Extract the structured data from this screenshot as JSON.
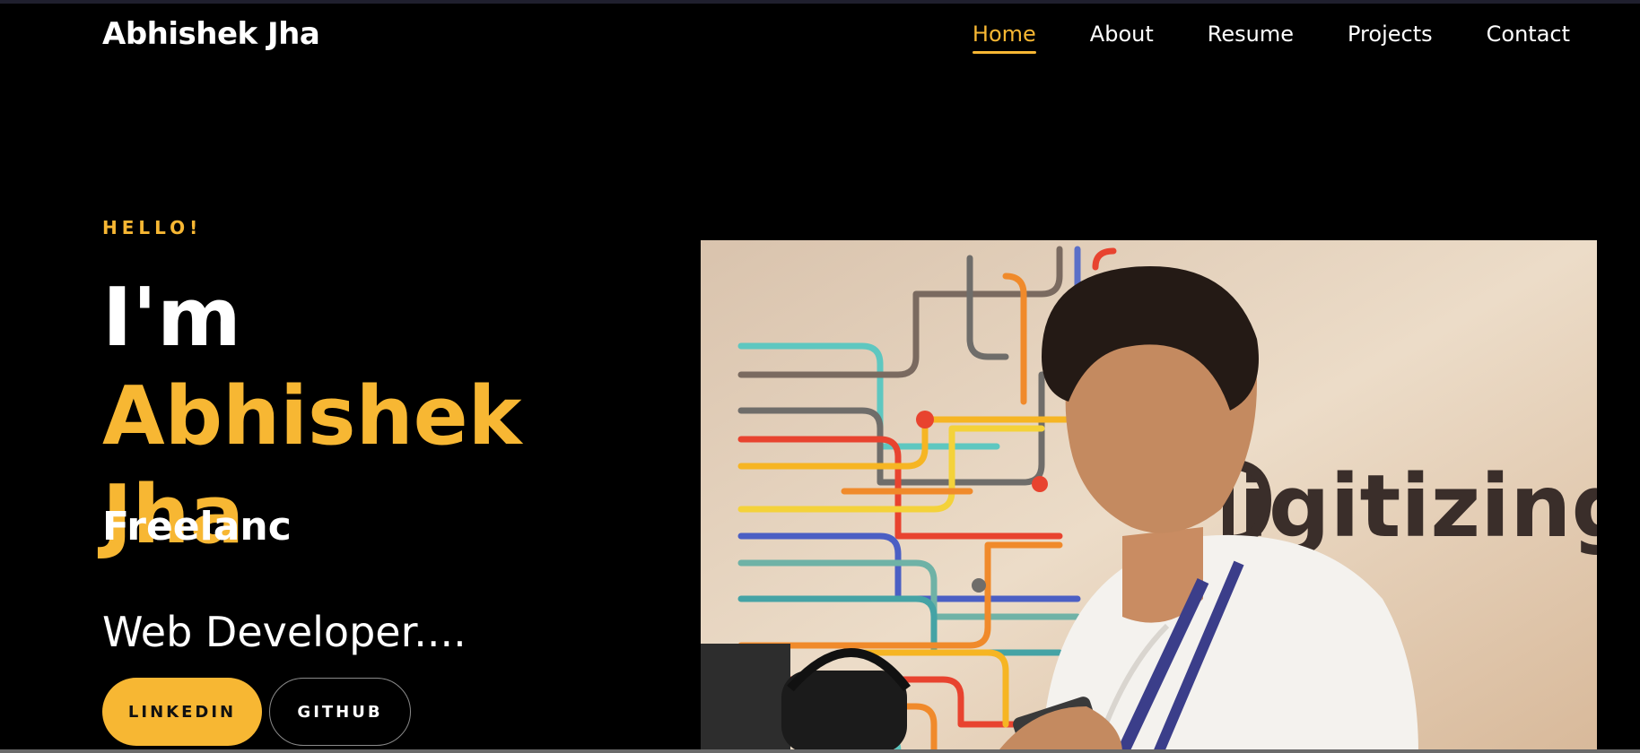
{
  "brand": {
    "name": "Abhishek Jha"
  },
  "nav": {
    "items": [
      {
        "label": "Home",
        "active": true
      },
      {
        "label": "About",
        "active": false
      },
      {
        "label": "Resume",
        "active": false
      },
      {
        "label": "Projects",
        "active": false
      },
      {
        "label": "Contact",
        "active": false
      }
    ]
  },
  "hero": {
    "greeting": "HELLO!",
    "headline_prefix": "I'm ",
    "headline_name": "Abhishek Jha",
    "typed_role": "Freelanc",
    "role_line": "Web Developer....",
    "buttons": {
      "linkedin": "LINKEDIN",
      "github": "GITHUB"
    },
    "photo": {
      "wall_text": "Digitizing"
    }
  },
  "colors": {
    "accent": "#f7b733",
    "background": "#000000",
    "text": "#ffffff"
  }
}
